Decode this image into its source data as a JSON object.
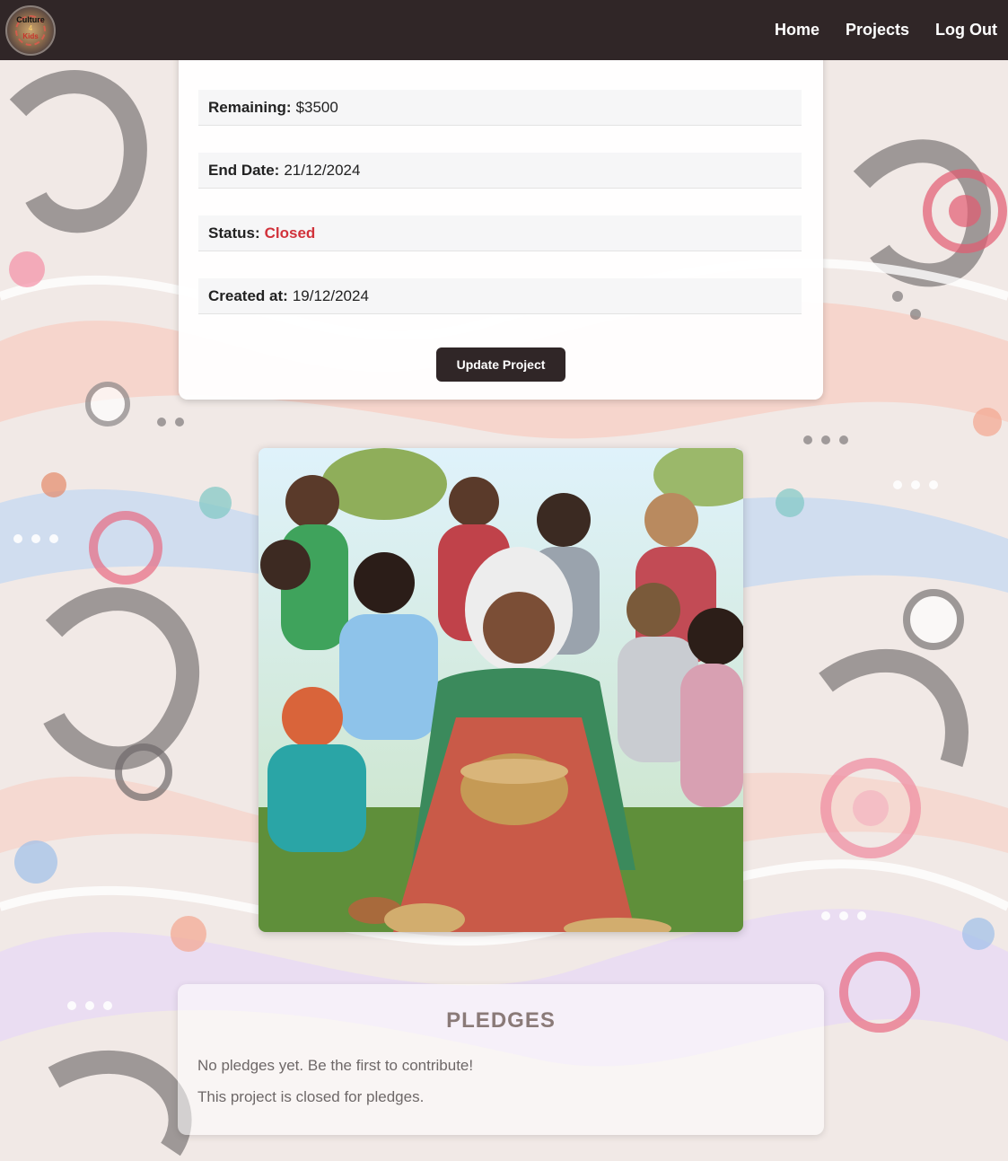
{
  "nav": {
    "logo_text_top": "Culture",
    "logo_text_mid": "4",
    "logo_text_bottom": "Kids",
    "links": [
      "Home",
      "Projects",
      "Log Out"
    ]
  },
  "project": {
    "remaining_label": "Remaining:",
    "remaining_value": "$3500",
    "end_date_label": "End Date:",
    "end_date_value": "21/12/2024",
    "status_label": "Status:",
    "status_value": "Closed",
    "created_label": "Created at:",
    "created_value": "19/12/2024",
    "update_button": "Update Project"
  },
  "pledges": {
    "title": "PLEDGES",
    "empty_text": "No pledges yet. Be the first to contribute!",
    "closed_text": "This project is closed for pledges."
  },
  "colors": {
    "navbar": "#302627",
    "status_closed": "#d1323b",
    "button": "#302627"
  }
}
